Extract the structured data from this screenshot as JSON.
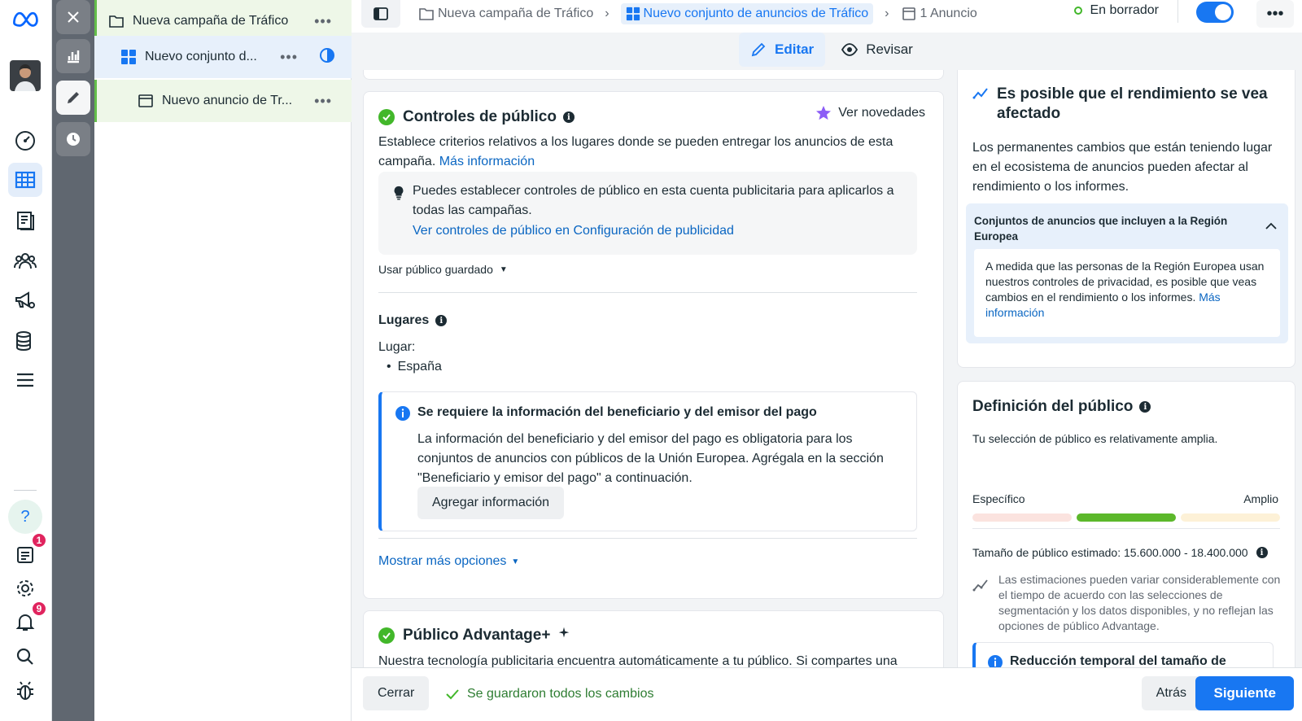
{
  "breadcrumb": {
    "campaign": "Nueva campaña de Tráfico",
    "adset": "Nuevo conjunto de anuncios de Tráfico",
    "ad": "1 Anuncio"
  },
  "status": {
    "label": "En borrador",
    "toggle_on": true
  },
  "tree": {
    "campaign": "Nueva campaña de Tráfico",
    "adset": "Nuevo conjunto d...",
    "ad": "Nuevo anuncio de Tr..."
  },
  "mode_tabs": {
    "edit": "Editar",
    "review": "Revisar"
  },
  "left_nav": {
    "icons": [
      "meta-logo-icon",
      "avatar",
      "dashboard-icon",
      "ads-manager-icon",
      "pages-icon",
      "audiences-icon",
      "campaign-settings-icon",
      "data-icon",
      "menu-icon",
      "help-icon",
      "notifications-list-icon",
      "settings-icon",
      "bell-icon",
      "search-icon",
      "bug-icon"
    ],
    "notif_list_badge": "1",
    "bell_badge": "9"
  },
  "audience_controls": {
    "title": "Controles de público",
    "whats_new": "Ver novedades",
    "desc": "Establece criterios relativos a los lugares donde se pueden entregar los anuncios de esta campaña.",
    "more_info": "Más información",
    "tip_text": "Puedes establecer controles de público en esta cuenta publicitaria para aplicarlos a todas las campañas.",
    "tip_link": "Ver controles de público en Configuración de publicidad",
    "saved_audience": "Usar público guardado",
    "places_title": "Lugares",
    "place_label": "Lugar:",
    "place_value": "España",
    "banner_title": "Se requiere la información del beneficiario y del emisor del pago",
    "banner_text": "La información del beneficiario y del emisor del pago es obligatoria para los conjuntos de anuncios con públicos de la Unión Europea. Agrégala en la sección \"Beneficiario y emisor del pago\" a continuación.",
    "banner_button": "Agregar información",
    "show_more": "Mostrar más opciones"
  },
  "advantage": {
    "title": "Público Advantage+",
    "desc": "Nuestra tecnología publicitaria encuentra automáticamente a tu público. Si compartes una"
  },
  "performance": {
    "title": "Es posible que el rendimiento se vea afectado",
    "desc": "Los permanentes cambios que están teniendo lugar en el ecosistema de anuncios pueden afectar al rendimiento o los informes.",
    "accordion_title": "Conjuntos de anuncios que incluyen a la Región Europea",
    "accordion_text": "A medida que las personas de la Región Europea usan nuestros controles de privacidad, es posible que veas cambios en el rendimiento o los informes.",
    "accordion_link": "Más información"
  },
  "audience_definition": {
    "title": "Definición del público",
    "subtitle": "Tu selección de público es relativamente amplia.",
    "specific": "Específico",
    "broad": "Amplio",
    "meter_segment": "2 of 3",
    "size_label": "Tamaño de público estimado: 15.600.000 - 18.400.000",
    "note": "Las estimaciones pueden variar considerablemente con el tiempo de acuerdo con las selecciones de segmentación y los datos disponibles, y no reflejan las opciones de público Advantage.",
    "reduction_title": "Reducción temporal del tamaño de"
  },
  "footer": {
    "close": "Cerrar",
    "saved": "Se guardaron todos los cambios",
    "back": "Atrás",
    "next": "Siguiente"
  },
  "colors": {
    "brand": "#1877f2",
    "success": "#42b72a",
    "sidebar_dark": "#606770"
  }
}
